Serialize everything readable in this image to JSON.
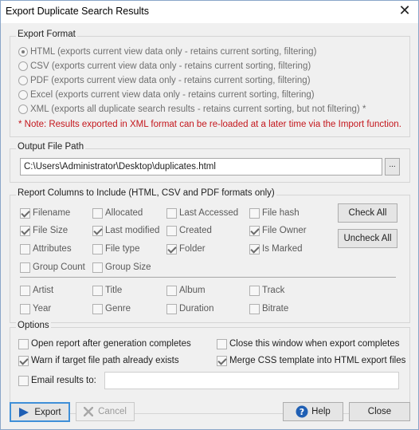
{
  "window": {
    "title": "Export Duplicate Search Results",
    "close_glyph": "✕"
  },
  "export_format": {
    "title": "Export Format",
    "options": [
      {
        "label": "HTML (exports current view data only - retains current sorting, filtering)",
        "selected": true
      },
      {
        "label": "CSV (exports current view data only - retains current sorting, filtering)",
        "selected": false
      },
      {
        "label": "PDF (exports current view data only - retains current sorting, filtering)",
        "selected": false
      },
      {
        "label": "Excel (exports current view data only - retains current sorting, filtering)",
        "selected": false
      },
      {
        "label": "XML (exports all duplicate search results - retains current sorting, but not filtering) *",
        "selected": false
      }
    ],
    "note": "* Note: Results exported in XML format can be re-loaded at a later time via the Import function."
  },
  "output": {
    "title": "Output File Path",
    "path": "C:\\Users\\Administrator\\Desktop\\duplicates.html",
    "browse_label": "..."
  },
  "columns": {
    "title": "Report Columns to Include (HTML, CSV and PDF formats only)",
    "items": [
      {
        "label": "Filename",
        "checked": true
      },
      {
        "label": "Allocated",
        "checked": false
      },
      {
        "label": "Last Accessed",
        "checked": false
      },
      {
        "label": "File hash",
        "checked": false
      },
      {
        "label": "File Size",
        "checked": true
      },
      {
        "label": "Last modified",
        "checked": true
      },
      {
        "label": "Created",
        "checked": false
      },
      {
        "label": "File Owner",
        "checked": true
      },
      {
        "label": "Attributes",
        "checked": false
      },
      {
        "label": "File type",
        "checked": false
      },
      {
        "label": "Folder",
        "checked": true
      },
      {
        "label": "Is Marked",
        "checked": true
      },
      {
        "label": "Group Count",
        "checked": false
      },
      {
        "label": "Group Size",
        "checked": false
      }
    ],
    "media_items": [
      {
        "label": "Artist",
        "checked": false
      },
      {
        "label": "Title",
        "checked": false
      },
      {
        "label": "Album",
        "checked": false
      },
      {
        "label": "Track",
        "checked": false
      },
      {
        "label": "Year",
        "checked": false
      },
      {
        "label": "Genre",
        "checked": false
      },
      {
        "label": "Duration",
        "checked": false
      },
      {
        "label": "Bitrate",
        "checked": false
      }
    ],
    "check_all_label": "Check All",
    "uncheck_all_label": "Uncheck All"
  },
  "options": {
    "title": "Options",
    "open_report": {
      "label": "Open report after generation completes",
      "checked": false
    },
    "close_window": {
      "label": "Close this window when export completes",
      "checked": false
    },
    "warn_exists": {
      "label": "Warn if target file path already exists",
      "checked": true
    },
    "merge_css": {
      "label": "Merge CSS template into HTML export files",
      "checked": true
    },
    "email": {
      "label": "Email results to:",
      "checked": false,
      "value": ""
    }
  },
  "buttons": {
    "export": "Export",
    "cancel": "Cancel",
    "help": "Help",
    "close": "Close"
  },
  "colors": {
    "accent": "#3f8fd8",
    "note": "#c4161c",
    "export_icon": "#1f5fb4",
    "help_icon": "#1f5fb4"
  }
}
